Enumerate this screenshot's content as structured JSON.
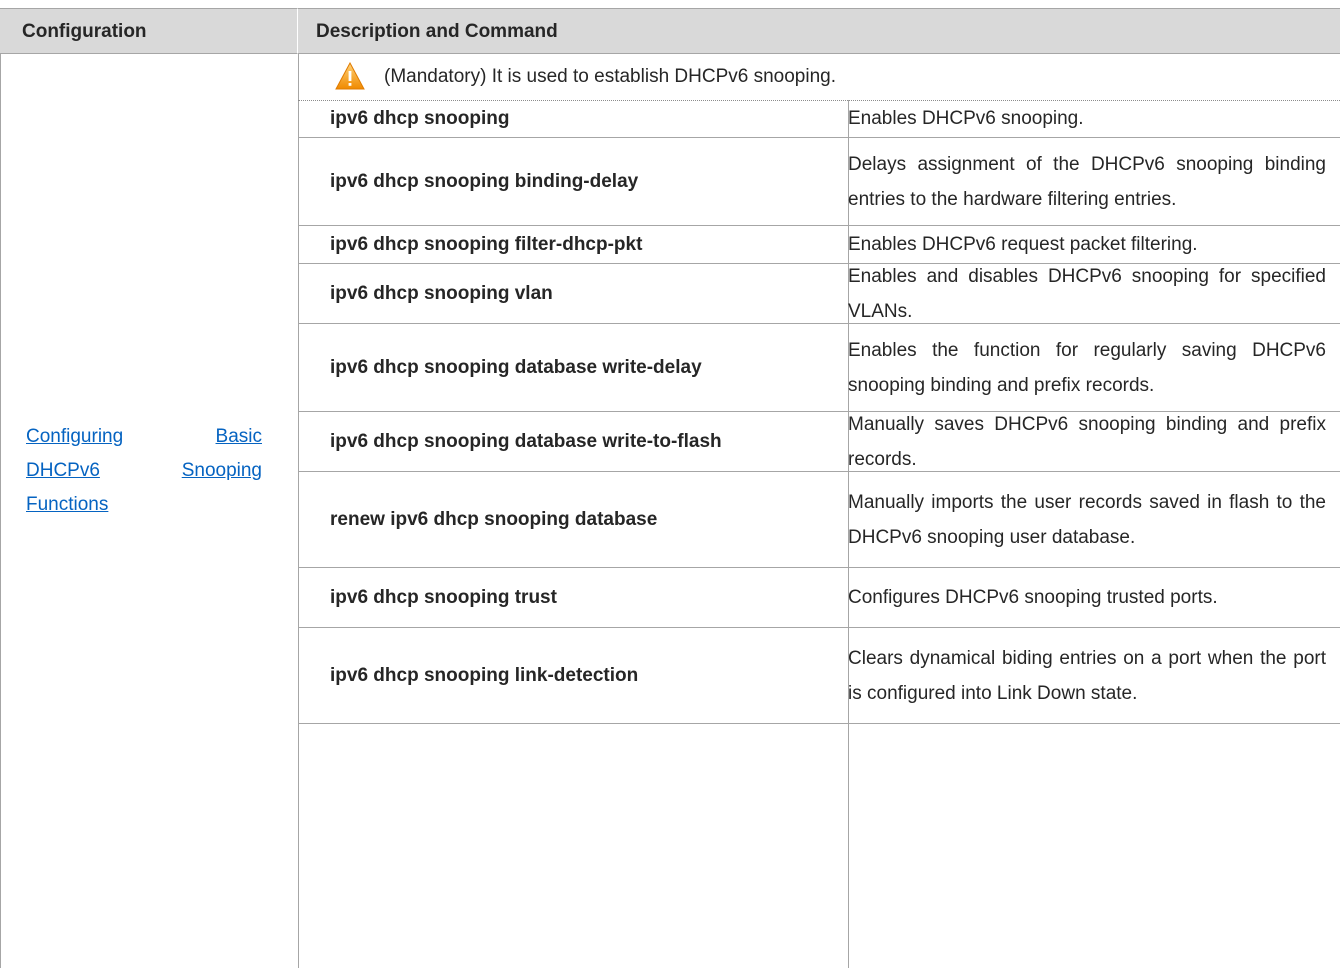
{
  "table": {
    "headers": {
      "configuration": "Configuration",
      "description": "Description and Command"
    },
    "configuration_link": {
      "line1a": "Configuring",
      "line1b": "Basic",
      "line2a": "DHCPv6",
      "line2b": "Snooping",
      "line3": "Functions"
    },
    "note": {
      "text": "(Mandatory) It is used to establish DHCPv6 snooping.",
      "icon": "warning-icon"
    },
    "rows": [
      {
        "command": "ipv6 dhcp snooping",
        "description": "Enables DHCPv6 snooping."
      },
      {
        "command": "ipv6 dhcp snooping binding-delay",
        "description": "Delays assignment of the DHCPv6 snooping binding entries to the hardware filtering entries."
      },
      {
        "command": "ipv6 dhcp snooping filter-dhcp-pkt",
        "description": "Enables DHCPv6 request packet filtering."
      },
      {
        "command": "ipv6 dhcp snooping vlan",
        "description": "Enables and disables DHCPv6 snooping for specified VLANs."
      },
      {
        "command": "ipv6 dhcp snooping database write-delay",
        "description": "Enables the function for regularly saving DHCPv6 snooping binding and prefix records."
      },
      {
        "command": "ipv6 dhcp snooping database write-to-flash",
        "description": "Manually saves DHCPv6 snooping binding and prefix records."
      },
      {
        "command": "renew ipv6 dhcp snooping database",
        "description": "Manually imports the user records saved in flash to the DHCPv6 snooping user database."
      },
      {
        "command": "ipv6 dhcp snooping trust",
        "description": "Configures DHCPv6 snooping trusted ports."
      },
      {
        "command": "ipv6 dhcp snooping link-detection",
        "description": "Clears dynamical biding entries on a port when the port is configured into Link Down state."
      }
    ]
  },
  "colors": {
    "header_bg": "#d9d9d9",
    "link": "#0563c1",
    "warning": "#f5a623"
  }
}
